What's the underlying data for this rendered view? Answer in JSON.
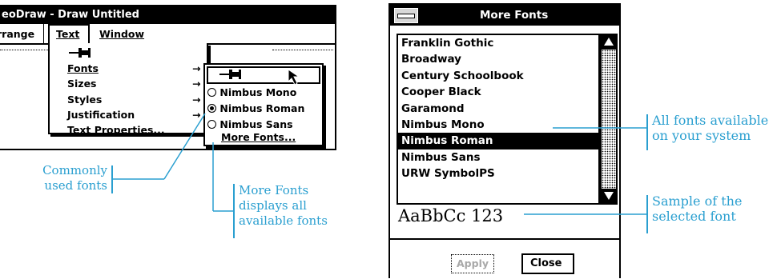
{
  "left_window": {
    "title": "eoDraw - Draw Untitled",
    "menubar": [
      {
        "label": "rrange"
      },
      {
        "label": "Text"
      },
      {
        "label": "Window"
      }
    ],
    "text_menu": {
      "items": [
        {
          "label": "Fonts",
          "has_submenu": true
        },
        {
          "label": "Sizes",
          "has_submenu": true
        },
        {
          "label": "Styles",
          "has_submenu": true
        },
        {
          "label": "Justification",
          "has_submenu": true
        },
        {
          "label": "Text Properties..."
        }
      ]
    },
    "fonts_submenu": {
      "items": [
        {
          "label": "Nimbus Mono",
          "selected": false
        },
        {
          "label": "Nimbus Roman",
          "selected": true
        },
        {
          "label": "Nimbus Sans",
          "selected": false
        }
      ],
      "more": "More Fonts..."
    }
  },
  "more_fonts_dialog": {
    "title": "More Fonts",
    "fonts": [
      "Franklin Gothic",
      "Broadway",
      "Century Schoolbook",
      "Cooper Black",
      "Garamond",
      "Nimbus Mono",
      "Nimbus Roman",
      "Nimbus Sans",
      "URW SymbolPS"
    ],
    "selected_font": "Nimbus Roman",
    "sample": "AaBbCc 123",
    "apply_label": "Apply",
    "close_label": "Close"
  },
  "annotations": {
    "common": [
      "Commonly",
      "used fonts"
    ],
    "more": [
      "More Fonts",
      "displays all",
      "available fonts"
    ],
    "all": [
      "All fonts available",
      "on your system"
    ],
    "sample": [
      "Sample of the",
      "selected font"
    ]
  },
  "colors": {
    "annotation": "#2a9fd0",
    "selection": "#000000"
  }
}
